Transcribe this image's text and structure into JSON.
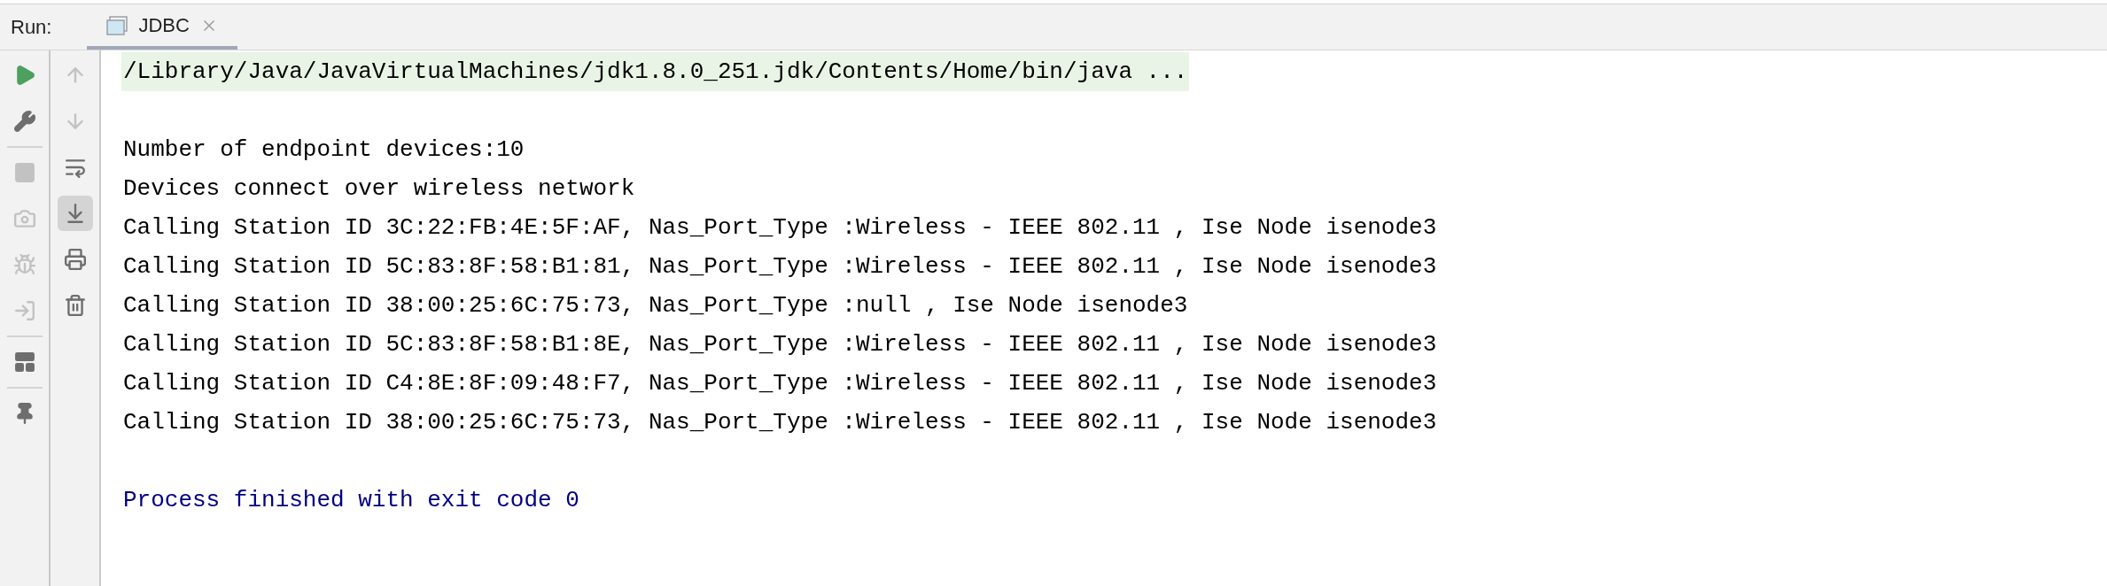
{
  "header": {
    "label": "Run:",
    "tabs": [
      {
        "label": "JDBC",
        "selected": true
      }
    ]
  },
  "left_toolbar": [
    [
      {
        "kind": "run",
        "disabled": false
      },
      {
        "kind": "settings",
        "disabled": false
      }
    ],
    [
      {
        "kind": "stop",
        "disabled": true
      },
      {
        "kind": "camera",
        "disabled": true
      },
      {
        "kind": "debug",
        "disabled": true
      },
      {
        "kind": "exit",
        "disabled": true
      }
    ],
    [
      {
        "kind": "layout",
        "disabled": false
      }
    ],
    [
      {
        "kind": "pin",
        "disabled": false
      }
    ]
  ],
  "right_toolbar": [
    {
      "kind": "up",
      "disabled": true,
      "selected": false
    },
    {
      "kind": "down",
      "disabled": true,
      "selected": false
    },
    {
      "kind": "wrap",
      "disabled": false,
      "selected": false
    },
    {
      "kind": "scroll-end",
      "disabled": false,
      "selected": true
    },
    {
      "kind": "print",
      "disabled": false,
      "selected": false
    },
    {
      "kind": "trash",
      "disabled": false,
      "selected": false
    }
  ],
  "console": {
    "command": "/Library/Java/JavaVirtualMachines/jdk1.8.0_251.jdk/Contents/Home/bin/java ...",
    "output": [
      "Number of endpoint devices:10",
      "Devices connect over wireless network",
      "Calling Station ID 3C:22:FB:4E:5F:AF, Nas_Port_Type :Wireless - IEEE 802.11 , Ise Node isenode3",
      "Calling Station ID 5C:83:8F:58:B1:81, Nas_Port_Type :Wireless - IEEE 802.11 , Ise Node isenode3",
      "Calling Station ID 38:00:25:6C:75:73, Nas_Port_Type :null , Ise Node isenode3",
      "Calling Station ID 5C:83:8F:58:B1:8E, Nas_Port_Type :Wireless - IEEE 802.11 , Ise Node isenode3",
      "Calling Station ID C4:8E:8F:09:48:F7, Nas_Port_Type :Wireless - IEEE 802.11 , Ise Node isenode3",
      "Calling Station ID 38:00:25:6C:75:73, Nas_Port_Type :Wireless - IEEE 802.11 , Ise Node isenode3"
    ],
    "exit_message": "Process finished with exit code 0"
  }
}
